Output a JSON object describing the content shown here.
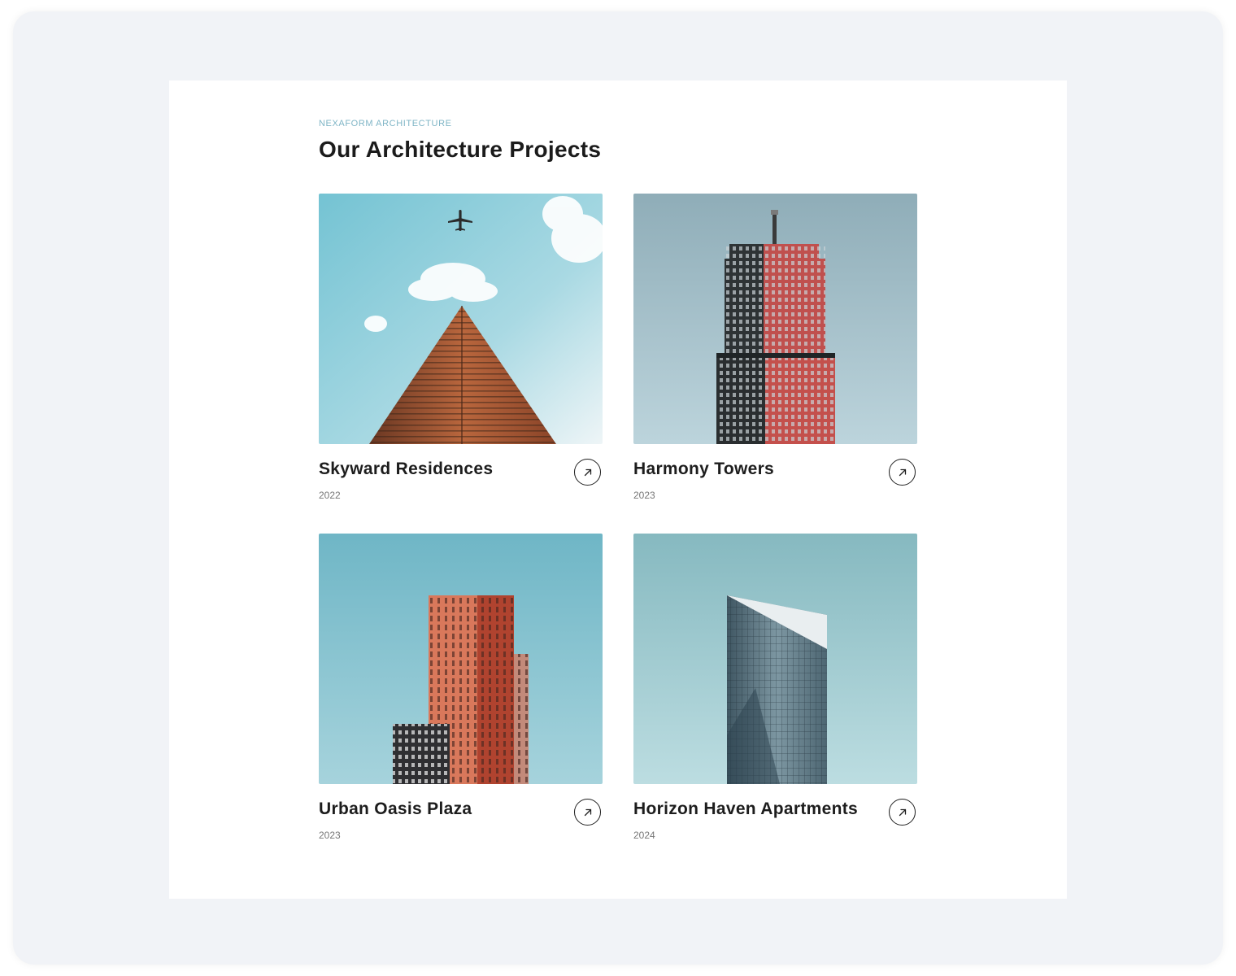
{
  "header": {
    "eyebrow": "NEXAFORM  ARCHITECTURE",
    "title": "Our Architecture Projects"
  },
  "projects": [
    {
      "name": "Skyward Residences",
      "year": "2022",
      "image": "skyscraper-with-airplane"
    },
    {
      "name": "Harmony Towers",
      "year": "2023",
      "image": "red-and-dark-tower"
    },
    {
      "name": "Urban Oasis Plaza",
      "year": "2023",
      "image": "terracotta-block-building"
    },
    {
      "name": "Horizon Haven Apartments",
      "year": "2024",
      "image": "glass-angled-tower"
    }
  ],
  "icons": {
    "open": "arrow-up-right-icon"
  },
  "colors": {
    "accent": "#7fb5c6",
    "title": "#1b1b1b",
    "year": "#777777",
    "sky": "#7cc0d2"
  }
}
